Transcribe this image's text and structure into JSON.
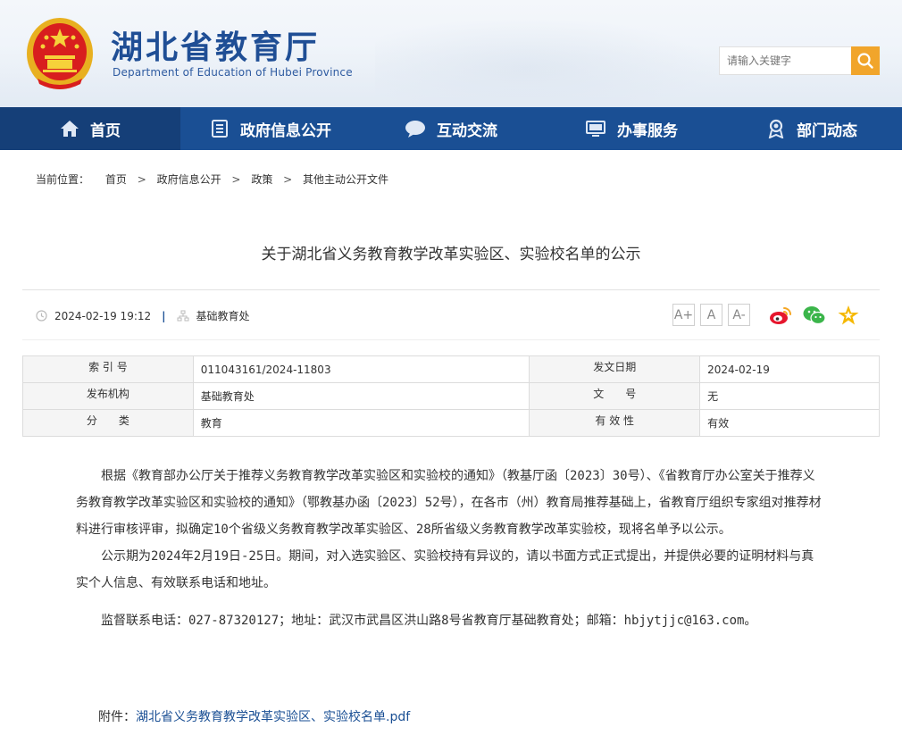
{
  "header": {
    "site_title": "湖北省教育厅",
    "site_subtitle": "Department of Education of Hubei Province",
    "search_placeholder": "请输入关键字"
  },
  "nav": [
    {
      "label": "首页",
      "icon": "home-icon",
      "active": true
    },
    {
      "label": "政府信息公开",
      "icon": "document-list-icon",
      "active": false
    },
    {
      "label": "互动交流",
      "icon": "chat-bubble-icon",
      "active": false
    },
    {
      "label": "办事服务",
      "icon": "monitor-icon",
      "active": false
    },
    {
      "label": "部门动态",
      "icon": "badge-icon",
      "active": false
    }
  ],
  "breadcrumb": {
    "label": "当前位置：",
    "items": [
      "首页",
      "政府信息公开",
      "政策",
      "其他主动公开文件"
    ],
    "separator": ">"
  },
  "article": {
    "title": "关于湖北省义务教育教学改革实验区、实验校名单的公示",
    "datetime": "2024-02-19 19:12",
    "department": "基础教育处"
  },
  "font_buttons": [
    "A+",
    "A",
    "A-"
  ],
  "share_icons": [
    "weibo-icon",
    "wechat-icon",
    "favorite-star-icon"
  ],
  "info": {
    "index_label": "索 引 号",
    "index_value": "011043161/2024-11803",
    "date_label": "发文日期",
    "date_value": "2024-02-19",
    "org_label": "发布机构",
    "org_value": "基础教育处",
    "docno_label": "文　　号",
    "docno_value": "无",
    "category_label": "分　　类",
    "category_value": "教育",
    "validity_label": "有 效 性",
    "validity_value": "有效"
  },
  "body": {
    "p1": "根据《教育部办公厅关于推荐义务教育教学改革实验区和实验校的通知》（教基厅函〔2023〕30号）、《省教育厅办公室关于推荐义务教育教学改革实验区和实验校的通知》（鄂教基办函〔2023〕52号），在各市（州）教育局推荐基础上，省教育厅组织专家组对推荐材料进行审核评审，拟确定10个省级义务教育教学改革实验区、28所省级义务教育教学改革实验校，现将名单予以公示。",
    "p2": "公示期为2024年2月19日-25日。期间，对入选实验区、实验校持有异议的，请以书面方式正式提出，并提供必要的证明材料与真实个人信息、有效联系电话和地址。",
    "p3": "监督联系电话：027-87320127；地址：武汉市武昌区洪山路8号省教育厅基础教育处；邮箱：hbjytjjc@163.com。"
  },
  "attachment": {
    "label": "附件：",
    "link": "湖北省义务教育教学改革实验区、实验校名单.pdf"
  },
  "colors": {
    "nav_bg": "#1a4f94",
    "nav_active": "#153f78",
    "title_blue": "#1f4e95",
    "search_btn": "#f1a52b"
  }
}
